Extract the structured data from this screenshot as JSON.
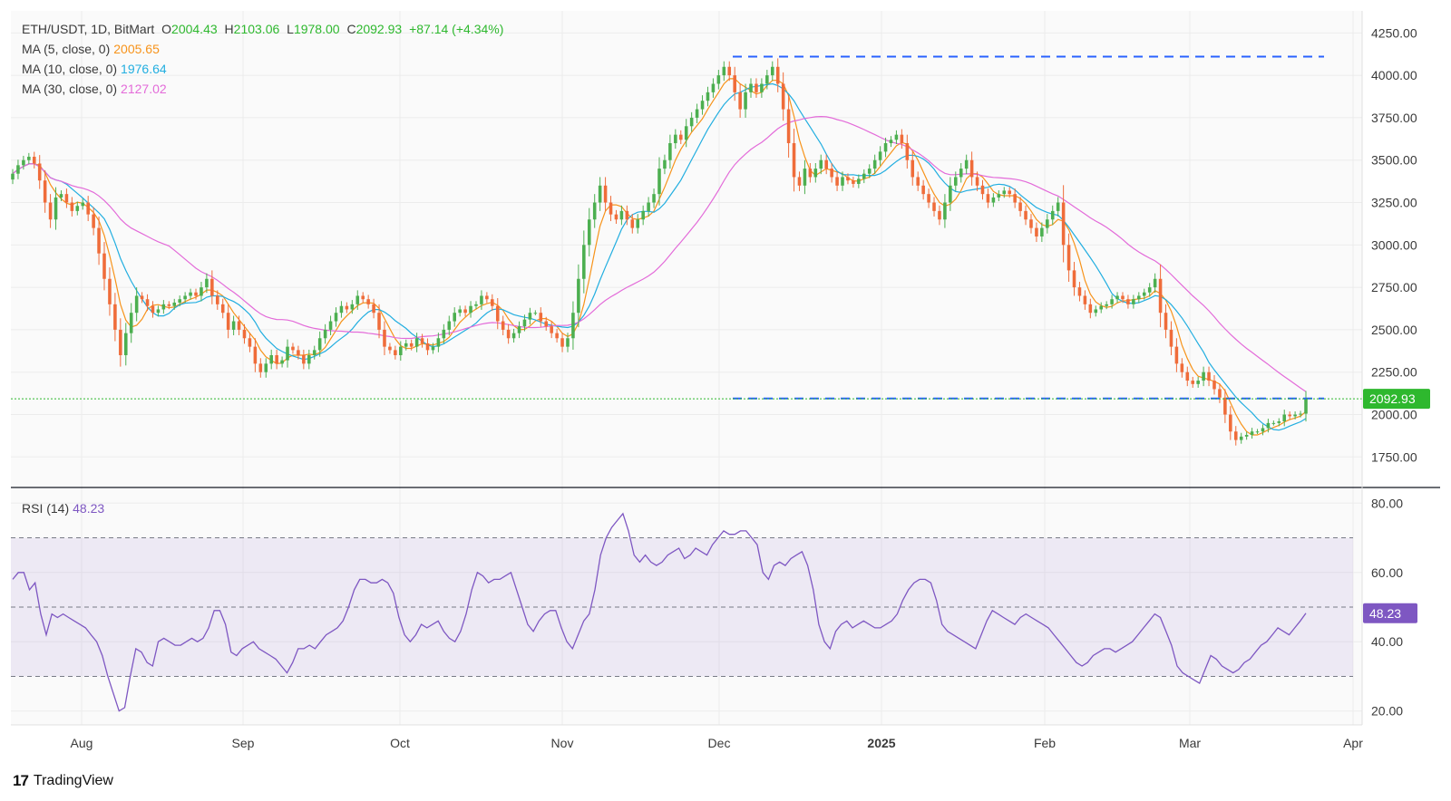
{
  "header": {
    "symbol_line": "ETH/USDT, 1D, BitMart",
    "o_label": "O",
    "o_value": "2004.43",
    "h_label": "H",
    "h_value": "2103.06",
    "l_label": "L",
    "l_value": "1978.00",
    "c_label": "C",
    "c_value": "2092.93",
    "change": "+87.14 (+4.34%)",
    "ma5_label": "MA (5, close, 0)",
    "ma5_value": "2005.65",
    "ma10_label": "MA (10, close, 0)",
    "ma10_value": "1976.64",
    "ma30_label": "MA (30, close, 0)",
    "ma30_value": "2127.02",
    "rsi_label": "RSI (14)",
    "rsi_value": "48.23"
  },
  "colors": {
    "up": "#26a69a",
    "up_body": "#4caf50",
    "down": "#ef6c3a",
    "ma5": "#f7931a",
    "ma10": "#22aee0",
    "ma30": "#e36bd9",
    "rsi": "#7e57c2",
    "level": "#2962ff",
    "price_tag": "#2eb82e"
  },
  "brand": {
    "logo": "17",
    "name": "TradingView"
  },
  "chart_data": [
    {
      "type": "candlestick",
      "title": "ETH/USDT, 1D, BitMart",
      "x_ticks": [
        "Aug",
        "Sep",
        "Oct",
        "Nov",
        "Dec",
        "2025",
        "Feb",
        "Mar",
        "Apr"
      ],
      "y_ticks": [
        "1750.00",
        "2000.00",
        "2250.00",
        "2500.00",
        "2750.00",
        "3000.00",
        "3250.00",
        "3500.00",
        "3750.00",
        "4000.00",
        "4250.00"
      ],
      "ylim": [
        1570,
        4380
      ],
      "last_price_label": "2092.93",
      "resistance_level": 4110,
      "support_level": 2095,
      "close_series": [
        3420,
        3470,
        3500,
        3520,
        3480,
        3380,
        3250,
        3150,
        3280,
        3300,
        3250,
        3200,
        3230,
        3250,
        3180,
        3100,
        2950,
        2800,
        2650,
        2500,
        2350,
        2480,
        2600,
        2700,
        2680,
        2640,
        2600,
        2620,
        2650,
        2640,
        2660,
        2680,
        2700,
        2720,
        2700,
        2750,
        2800,
        2700,
        2650,
        2600,
        2500,
        2550,
        2500,
        2450,
        2400,
        2300,
        2250,
        2300,
        2350,
        2300,
        2320,
        2400,
        2380,
        2350,
        2300,
        2350,
        2380,
        2450,
        2500,
        2550,
        2600,
        2640,
        2620,
        2650,
        2700,
        2680,
        2650,
        2600,
        2500,
        2400,
        2380,
        2350,
        2400,
        2420,
        2400,
        2450,
        2420,
        2380,
        2400,
        2450,
        2500,
        2550,
        2600,
        2620,
        2600,
        2640,
        2650,
        2700,
        2680,
        2640,
        2550,
        2500,
        2450,
        2480,
        2520,
        2560,
        2600,
        2600,
        2550,
        2520,
        2480,
        2450,
        2400,
        2450,
        2600,
        2800,
        3000,
        3150,
        3250,
        3350,
        3250,
        3180,
        3150,
        3200,
        3150,
        3100,
        3150,
        3200,
        3250,
        3300,
        3450,
        3500,
        3600,
        3650,
        3620,
        3700,
        3750,
        3800,
        3850,
        3900,
        3950,
        4000,
        4050,
        4000,
        3900,
        3800,
        3900,
        3950,
        3900,
        3950,
        4000,
        4050,
        3950,
        3800,
        3600,
        3400,
        3350,
        3450,
        3400,
        3450,
        3500,
        3450,
        3400,
        3350,
        3400,
        3380,
        3360,
        3390,
        3420,
        3450,
        3500,
        3550,
        3600,
        3620,
        3650,
        3600,
        3500,
        3400,
        3350,
        3300,
        3250,
        3200,
        3150,
        3250,
        3350,
        3400,
        3450,
        3500,
        3400,
        3350,
        3300,
        3250,
        3280,
        3300,
        3320,
        3300,
        3250,
        3200,
        3150,
        3100,
        3050,
        3100,
        3150,
        3200,
        3250,
        3000,
        2850,
        2750,
        2700,
        2650,
        2600,
        2620,
        2640,
        2650,
        2680,
        2700,
        2680,
        2650,
        2680,
        2700,
        2720,
        2750,
        2800,
        2600,
        2500,
        2400,
        2300,
        2250,
        2200,
        2180,
        2200,
        2250,
        2200,
        2150,
        2100,
        2000,
        1900,
        1850,
        1870,
        1880,
        1900,
        1900,
        1920,
        1950,
        1950,
        1960,
        2000,
        1990,
        2000,
        2005,
        2092.93
      ],
      "ma_series": [
        {
          "name": "MA (5, close, 0)",
          "last_value": 2005.65
        },
        {
          "name": "MA (10, close, 0)",
          "last_value": 1976.64
        },
        {
          "name": "MA (30, close, 0)",
          "last_value": 2127.02
        }
      ]
    },
    {
      "type": "line",
      "title": "RSI (14)",
      "y_ticks": [
        "20.00",
        "40.00",
        "60.00",
        "80.00"
      ],
      "ylim": [
        16,
        84
      ],
      "bands": [
        30,
        50,
        70
      ],
      "last_value_label": "48.23",
      "values": [
        58,
        60,
        60,
        55,
        57,
        48,
        42,
        48,
        47,
        48,
        47,
        46,
        45,
        44,
        42,
        40,
        36,
        30,
        25,
        20,
        21,
        30,
        38,
        37,
        34,
        33,
        40,
        41,
        40,
        39,
        39,
        40,
        41,
        40,
        41,
        44,
        49,
        49,
        45,
        37,
        36,
        38,
        39,
        40,
        38,
        37,
        36,
        35,
        33,
        31,
        34,
        38,
        38,
        39,
        38,
        40,
        42,
        43,
        44,
        46,
        50,
        55,
        58,
        58,
        57,
        57,
        58,
        57,
        54,
        47,
        42,
        40,
        42,
        45,
        44,
        45,
        46,
        43,
        41,
        40,
        43,
        48,
        55,
        60,
        59,
        57,
        58,
        58,
        59,
        60,
        55,
        50,
        45,
        43,
        46,
        48,
        49,
        49,
        44,
        40,
        38,
        42,
        46,
        48,
        55,
        65,
        70,
        73,
        75,
        77,
        72,
        65,
        63,
        65,
        63,
        62,
        63,
        65,
        66,
        67,
        64,
        65,
        67,
        66,
        65,
        68,
        70,
        72,
        71,
        71,
        72,
        72,
        70,
        68,
        60,
        58,
        62,
        63,
        62,
        64,
        65,
        66,
        62,
        55,
        45,
        40,
        38,
        43,
        45,
        46,
        44,
        45,
        46,
        45,
        44,
        44,
        45,
        46,
        48,
        52,
        55,
        57,
        58,
        58,
        57,
        52,
        45,
        43,
        42,
        41,
        40,
        39,
        38,
        42,
        46,
        49,
        48,
        47,
        46,
        45,
        47,
        48,
        47,
        46,
        45,
        44,
        42,
        40,
        38,
        36,
        34,
        33,
        34,
        36,
        37,
        38,
        38,
        37,
        38,
        39,
        40,
        42,
        44,
        46,
        48,
        47,
        43,
        39,
        33,
        31,
        30,
        29,
        28,
        32,
        36,
        35,
        33,
        32,
        31,
        32,
        34,
        35,
        37,
        39,
        40,
        42,
        44,
        43,
        42,
        44,
        46,
        48.23
      ]
    }
  ]
}
